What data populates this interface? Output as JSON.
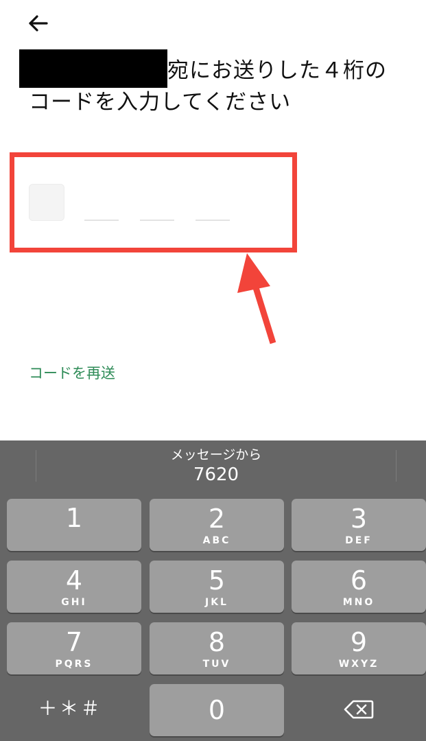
{
  "header": {
    "back_icon": "arrow-left-icon",
    "title": "宛にお送りした４桁の\nコードを入力してください"
  },
  "code_input": {
    "digits": [
      "",
      "",
      "",
      ""
    ],
    "highlight_color": "#f2443a"
  },
  "resend_label": "コードを再送",
  "keyboard": {
    "suggestion_label": "メッセージから",
    "suggestion_code": "7620",
    "keys": [
      {
        "num": "1",
        "letters": ""
      },
      {
        "num": "2",
        "letters": "ABC"
      },
      {
        "num": "3",
        "letters": "DEF"
      },
      {
        "num": "4",
        "letters": "GHI"
      },
      {
        "num": "5",
        "letters": "JKL"
      },
      {
        "num": "6",
        "letters": "MNO"
      },
      {
        "num": "7",
        "letters": "PQRS"
      },
      {
        "num": "8",
        "letters": "TUV"
      },
      {
        "num": "9",
        "letters": "WXYZ"
      }
    ],
    "symbols_label": "＋＊＃",
    "zero": "0",
    "delete_icon": "backspace-icon"
  },
  "colors": {
    "accent_green": "#2e8b57",
    "keyboard_bg": "#666666",
    "key_bg": "#9e9e9e",
    "annotation_red": "#f2443a"
  }
}
